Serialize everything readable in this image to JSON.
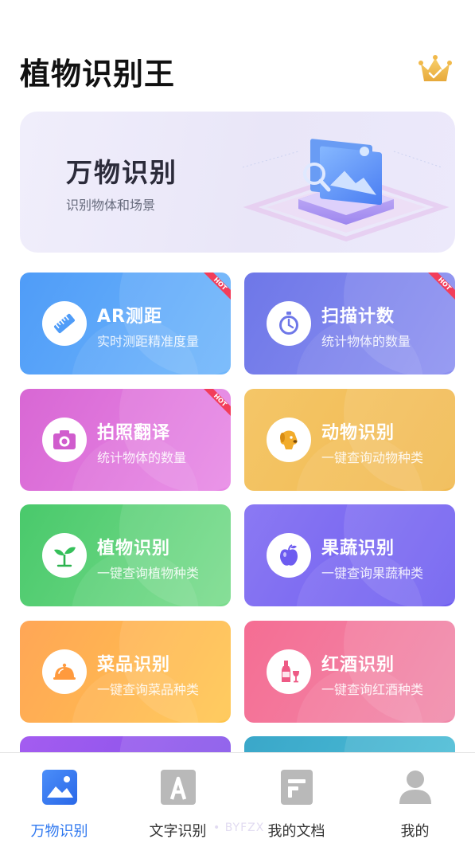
{
  "header": {
    "title": "植物识别王"
  },
  "banner": {
    "title": "万物识别",
    "subtitle": "识别物体和场景"
  },
  "hot_badge": "HOT",
  "cards": [
    {
      "title": "AR测距",
      "subtitle": "实时测距精准度量"
    },
    {
      "title": "扫描计数",
      "subtitle": "统计物体的数量"
    },
    {
      "title": "拍照翻译",
      "subtitle": "统计物体的数量"
    },
    {
      "title": "动物识别",
      "subtitle": "一键查询动物种类"
    },
    {
      "title": "植物识别",
      "subtitle": "一键查询植物种类"
    },
    {
      "title": "果蔬识别",
      "subtitle": "一键查询果蔬种类"
    },
    {
      "title": "菜品识别",
      "subtitle": "一键查询菜品种类"
    },
    {
      "title": "红酒识别",
      "subtitle": "一键查询红酒种类"
    }
  ],
  "tabs": [
    {
      "label": "万物识别",
      "active": true
    },
    {
      "label": "文字识别"
    },
    {
      "label": "我的文档"
    },
    {
      "label": "我的"
    }
  ],
  "watermark": "• BYFZX",
  "colors": {
    "accent": "#2f78f0",
    "hot": "#f23d5a"
  }
}
